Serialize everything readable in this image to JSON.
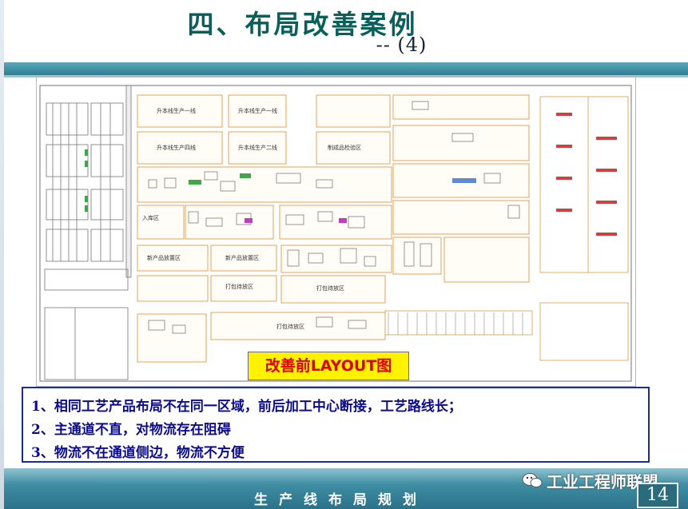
{
  "slide": {
    "title": "四、布局改善案例",
    "subtitle": "-- (4)",
    "footer": "生产线布局规划",
    "page_number": "14",
    "watermark": "工业工程师联盟"
  },
  "layout_image": {
    "caption": "改善前LAYOUT图",
    "regions": [
      {
        "label": "升本线生产一线"
      },
      {
        "label": "升本线生产一线"
      },
      {
        "label": "升本线生产四线"
      },
      {
        "label": "升本线生产二线"
      },
      {
        "label": "制成品检验区"
      },
      {
        "label": "入库区"
      },
      {
        "label": "新产品放置区"
      },
      {
        "label": "新产品放置区"
      },
      {
        "label": "打包待放区"
      },
      {
        "label": "打包待放区"
      },
      {
        "label": "打包待放区"
      }
    ]
  },
  "issues": [
    "1、相同工艺产品布局不在同一区域，前后加工中心断接，工艺路线长；",
    "2、主通道不直，对物流存在阻碍",
    "3、物流不在通道侧边，物流不方便"
  ],
  "colors": {
    "title": "#0b5f5a",
    "band": "#2d7e93",
    "caption_bg": "#fff200",
    "caption_text": "#e00000",
    "issue_border": "#1a2aa0",
    "issue_text": "#0c0c8a"
  }
}
